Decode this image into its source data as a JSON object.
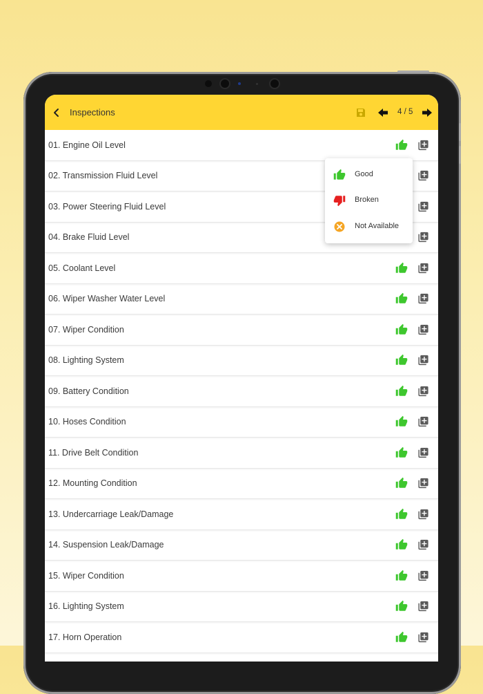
{
  "header": {
    "title": "Inspections",
    "page_indicator": "4 / 5"
  },
  "items": [
    {
      "label": "01. Engine Oil Level",
      "status": "thumbs-up-icon"
    },
    {
      "label": "02. Transmission Fluid Level",
      "status": "thumbs-up-icon"
    },
    {
      "label": "03. Power Steering Fluid Level",
      "status": "thumbs-up-icon"
    },
    {
      "label": "04. Brake Fluid Level",
      "status": "thumbs-up-icon"
    },
    {
      "label": "05. Coolant Level",
      "status": "thumbs-up-icon"
    },
    {
      "label": "06. Wiper Washer Water Level",
      "status": "thumbs-up-icon"
    },
    {
      "label": "07. Wiper Condition",
      "status": "thumbs-up-icon"
    },
    {
      "label": "08. Lighting System",
      "status": "thumbs-up-icon"
    },
    {
      "label": "09. Battery Condition",
      "status": "thumbs-up-icon"
    },
    {
      "label": "10. Hoses Condition",
      "status": "thumbs-up-icon"
    },
    {
      "label": "11. Drive Belt Condition",
      "status": "thumbs-up-icon"
    },
    {
      "label": "12. Mounting Condition",
      "status": "thumbs-up-icon"
    },
    {
      "label": "13. Undercarriage Leak/Damage",
      "status": "thumbs-up-icon"
    },
    {
      "label": "14. Suspension Leak/Damage",
      "status": "thumbs-up-icon"
    },
    {
      "label": "15. Wiper Condition",
      "status": "thumbs-up-icon"
    },
    {
      "label": "16. Lighting System",
      "status": "thumbs-up-icon"
    },
    {
      "label": "17. Horn Operation",
      "status": "thumbs-up-icon"
    }
  ],
  "popup": {
    "options": [
      {
        "label": "Good",
        "icon": "thumbs-up-icon"
      },
      {
        "label": "Broken",
        "icon": "thumbs-down-icon"
      },
      {
        "label": "Not Available",
        "icon": "not-available-icon"
      }
    ]
  },
  "colors": {
    "appbar": "#ffd633",
    "good": "#3ec72e",
    "broken": "#e62020",
    "not_available": "#f5a524",
    "icon_gray": "#5a5a5a"
  }
}
